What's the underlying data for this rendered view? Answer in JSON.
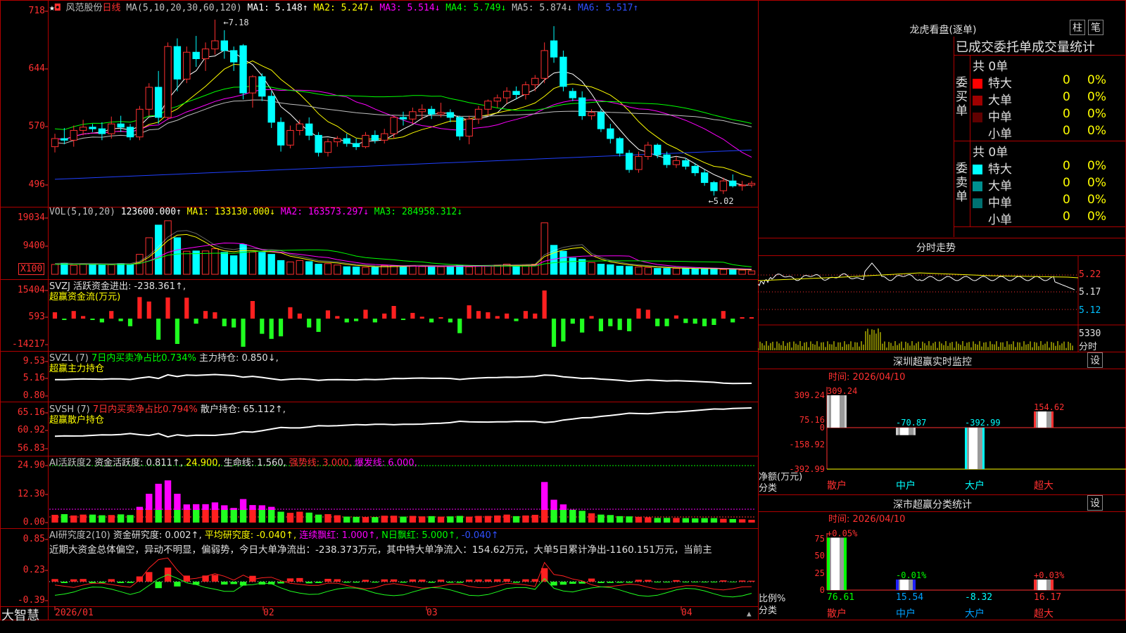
{
  "stock": {
    "name": "风范股份",
    "period": "日线",
    "ma_legend": [
      {
        "label": "MA(5,10,20,30,60,120)",
        "color": "#c0c0c0"
      },
      {
        "label": "MA1: 5.148↑",
        "color": "#ffffff"
      },
      {
        "label": "MA2: 5.247↓",
        "color": "#ffff00"
      },
      {
        "label": "MA3: 5.514↓",
        "color": "#ff00ff"
      },
      {
        "label": "MA4: 5.749↓",
        "color": "#00ff00"
      },
      {
        "label": "MA5: 5.874↓",
        "color": "#c0c0c0"
      },
      {
        "label": "MA6: 5.517↑",
        "color": "#3050ff"
      }
    ],
    "high_label": "7.18",
    "low_label": "5.02"
  },
  "price_axis": [
    "718",
    "644",
    "570",
    "496"
  ],
  "vol": {
    "legend": [
      {
        "label": "VOL(5,10,20)",
        "color": "#c0c0c0"
      },
      {
        "label": "123600.000↑",
        "color": "#ffffff"
      },
      {
        "label": "MA1: 133130.000↓",
        "color": "#ffff00"
      },
      {
        "label": "MA2: 163573.297↓",
        "color": "#ff00ff"
      },
      {
        "label": "MA3: 284958.312↓",
        "color": "#00ff00"
      }
    ],
    "axis": [
      "19034",
      "9400"
    ],
    "unit": "X100"
  },
  "svzj": {
    "legend": [
      {
        "label": "SVZJ  活跃资金进出: -238.361↑,",
        "color": "#e0e0e0"
      }
    ],
    "subtitle": "超赢资金流(万元)",
    "axis": [
      "15404",
      "593",
      "-14217"
    ]
  },
  "svzl": {
    "legend": [
      {
        "label": "SVZL (7)",
        "color": "#c0c0c0"
      },
      {
        "label": "7日内买卖净占比0.734%",
        "color": "#00ff00"
      },
      {
        "label": "主力持仓: 0.850↓,",
        "color": "#e0e0e0"
      }
    ],
    "subtitle": "超赢主力持仓",
    "axis": [
      "9.53",
      "5.16",
      "0.80"
    ]
  },
  "svsh": {
    "legend": [
      {
        "label": "SVSH (7)",
        "color": "#c0c0c0"
      },
      {
        "label": "7日内买卖净占比0.794%",
        "color": "#ff3030"
      },
      {
        "label": "散户持仓: 65.112↑,",
        "color": "#e0e0e0"
      }
    ],
    "subtitle": "超赢散户持仓",
    "axis": [
      "65.16",
      "60.92",
      "56.83"
    ]
  },
  "ai1": {
    "legend": [
      {
        "label": "AI活跃度2",
        "color": "#c0c0c0"
      },
      {
        "label": "资金活跃度: 0.811↑,",
        "color": "#e0e0e0"
      },
      {
        "label": "24.900,",
        "color": "#ffff00"
      },
      {
        "label": "生命线: 1.560,",
        "color": "#e0e0e0"
      },
      {
        "label": "强势线: 3.000,",
        "color": "#ff3030"
      },
      {
        "label": "爆发线: 6.000,",
        "color": "#ff00ff"
      }
    ],
    "axis": [
      "24.90",
      "12.30",
      "0.00"
    ]
  },
  "ai2": {
    "legend": [
      {
        "label": "AI研究度2(10)",
        "color": "#c0c0c0"
      },
      {
        "label": "资金研究度: 0.002↑,",
        "color": "#e0e0e0"
      },
      {
        "label": "平均研究度: -0.040↑,",
        "color": "#ffff00"
      },
      {
        "label": "连续飘红: 1.000↑,",
        "color": "#ff00ff"
      },
      {
        "label": "N日飘红: 5.000↑,",
        "color": "#00ff00"
      },
      {
        "label": "-0.040↑",
        "color": "#3050ff"
      }
    ],
    "comment": "近期大资金总体偏空，异动不明显，偏弱势，今日大单净流出：-238.373万元，其中特大单净流入：154.62万元，大单5日累计净出-1160.151万元，当前主",
    "axis": [
      "0.85",
      "0.23",
      "-0.39"
    ]
  },
  "date_axis": [
    "2026/01",
    "02",
    "03",
    "04"
  ],
  "brand": "大智慧",
  "right": {
    "lhb_title": "龙虎看盘(逐单)",
    "btn_zhu": "柱",
    "btn_bi": "笔",
    "stats_title": "已成交委托单成交量统计",
    "buy_label": "委买单",
    "sell_label": "委卖单",
    "buy_total": "共 0单",
    "sell_total": "共 0单",
    "buy_rows": [
      {
        "name": "特大",
        "val": "0",
        "pct": "0%",
        "color": "#ff0000"
      },
      {
        "name": "大单",
        "val": "0",
        "pct": "0%",
        "color": "#a00000"
      },
      {
        "name": "中单",
        "val": "0",
        "pct": "0%",
        "color": "#600000"
      },
      {
        "name": "小单",
        "val": "0",
        "pct": "0%",
        "color": ""
      }
    ],
    "sell_rows": [
      {
        "name": "特大",
        "val": "0",
        "pct": "0%",
        "color": "#00ffff"
      },
      {
        "name": "大单",
        "val": "0",
        "pct": "0%",
        "color": "#009090"
      },
      {
        "name": "中单",
        "val": "0",
        "pct": "0%",
        "color": "#007070"
      },
      {
        "name": "小单",
        "val": "0",
        "pct": "0%",
        "color": ""
      }
    ],
    "intraday_title": "分时走势",
    "intraday_axis": [
      "5.22",
      "5.17",
      "5.12"
    ],
    "intraday_vol": "5330",
    "intraday_unit": "分时",
    "sz_monitor_title": "深圳超赢实时监控",
    "sz_monitor_btn": "设",
    "sz_monitor_time": "时间: 2026/04/10",
    "sz_monitor_axis": [
      "309.24",
      "75.16",
      "0",
      "-158.92",
      "-392.99"
    ],
    "sz_monitor_ylabel": "净额(万元)",
    "sz_monitor_xlabel": "分类",
    "sz_classify_title": "深市超赢分类统计",
    "sz_classify_btn": "设",
    "sz_classify_time": "时间: 2026/04/10",
    "sz_classify_axis": [
      "75",
      "50",
      "25",
      "0"
    ],
    "sz_classify_ylabel": "比例%",
    "sz_classify_xlabel": "分类"
  },
  "chart_data": [
    {
      "type": "candlestick",
      "title": "风范股份 日线",
      "ylim": [
        4.9,
        7.3
      ],
      "ohlc": [
        [
          5.62,
          5.78,
          5.55,
          5.72
        ],
        [
          5.72,
          5.85,
          5.65,
          5.7
        ],
        [
          5.7,
          5.88,
          5.62,
          5.82
        ],
        [
          5.82,
          5.95,
          5.76,
          5.86
        ],
        [
          5.86,
          5.9,
          5.8,
          5.84
        ],
        [
          5.84,
          5.92,
          5.7,
          5.78
        ],
        [
          5.78,
          5.99,
          5.72,
          5.9
        ],
        [
          5.9,
          6.0,
          5.8,
          5.86
        ],
        [
          5.86,
          5.9,
          5.7,
          5.74
        ],
        [
          5.74,
          6.12,
          5.7,
          6.08
        ],
        [
          6.08,
          6.4,
          6.0,
          6.35
        ],
        [
          6.35,
          6.55,
          5.9,
          5.98
        ],
        [
          5.98,
          6.9,
          5.95,
          6.85
        ],
        [
          6.85,
          6.95,
          6.3,
          6.45
        ],
        [
          6.45,
          6.85,
          6.4,
          6.78
        ],
        [
          6.78,
          6.98,
          6.6,
          6.7
        ],
        [
          6.7,
          6.9,
          6.55,
          6.82
        ],
        [
          6.82,
          7.18,
          6.75,
          6.92
        ],
        [
          6.92,
          7.05,
          6.7,
          6.8
        ],
        [
          6.8,
          6.85,
          6.55,
          6.66
        ],
        [
          6.86,
          6.88,
          6.2,
          6.28
        ],
        [
          6.28,
          6.5,
          6.1,
          6.48
        ],
        [
          6.48,
          6.52,
          6.18,
          6.24
        ],
        [
          6.24,
          6.3,
          5.85,
          5.92
        ],
        [
          5.92,
          5.98,
          5.56,
          5.64
        ],
        [
          5.64,
          5.88,
          5.6,
          5.82
        ],
        [
          5.82,
          5.95,
          5.76,
          5.9
        ],
        [
          5.9,
          5.98,
          5.7,
          5.76
        ],
        [
          5.76,
          5.8,
          5.5,
          5.55
        ],
        [
          5.55,
          5.72,
          5.5,
          5.68
        ],
        [
          5.68,
          5.75,
          5.62,
          5.72
        ],
        [
          5.72,
          5.78,
          5.62,
          5.66
        ],
        [
          5.66,
          5.72,
          5.58,
          5.62
        ],
        [
          5.62,
          5.8,
          5.6,
          5.76
        ],
        [
          5.76,
          5.82,
          5.66,
          5.7
        ],
        [
          5.7,
          5.84,
          5.66,
          5.78
        ],
        [
          5.78,
          6.0,
          5.72,
          5.98
        ],
        [
          5.98,
          6.05,
          5.88,
          5.96
        ],
        [
          5.96,
          6.1,
          5.9,
          6.05
        ],
        [
          6.05,
          6.14,
          5.95,
          6.08
        ],
        [
          6.08,
          6.12,
          5.96,
          6.02
        ],
        [
          6.02,
          6.16,
          5.98,
          6.04
        ],
        [
          6.04,
          6.08,
          5.92,
          5.98
        ],
        [
          5.98,
          6.0,
          5.7,
          5.75
        ],
        [
          5.75,
          6.0,
          5.65,
          5.96
        ],
        [
          5.96,
          6.12,
          5.9,
          6.08
        ],
        [
          6.08,
          6.2,
          6.0,
          6.18
        ],
        [
          6.18,
          6.26,
          6.1,
          6.22
        ],
        [
          6.22,
          6.35,
          6.15,
          6.3
        ],
        [
          6.3,
          6.36,
          6.2,
          6.26
        ],
        [
          6.26,
          6.42,
          6.2,
          6.38
        ],
        [
          6.38,
          6.5,
          6.3,
          6.46
        ],
        [
          6.46,
          6.9,
          6.4,
          6.8
        ],
        [
          6.92,
          7.1,
          6.65,
          6.72
        ],
        [
          6.72,
          6.8,
          6.3,
          6.36
        ],
        [
          6.3,
          6.34,
          6.18,
          6.22
        ],
        [
          6.22,
          6.3,
          5.95,
          6.0
        ],
        [
          6.0,
          6.08,
          5.95,
          6.04
        ],
        [
          6.04,
          6.08,
          5.8,
          5.84
        ],
        [
          5.84,
          5.9,
          5.66,
          5.72
        ],
        [
          5.72,
          5.74,
          5.5,
          5.54
        ],
        [
          5.54,
          5.58,
          5.3,
          5.34
        ],
        [
          5.34,
          5.56,
          5.3,
          5.5
        ],
        [
          5.5,
          5.68,
          5.46,
          5.64
        ],
        [
          5.64,
          5.66,
          5.48,
          5.52
        ],
        [
          5.52,
          5.56,
          5.36,
          5.4
        ],
        [
          5.4,
          5.5,
          5.36,
          5.45
        ],
        [
          5.45,
          5.48,
          5.34,
          5.38
        ],
        [
          5.38,
          5.42,
          5.26,
          5.3
        ],
        [
          5.3,
          5.34,
          5.14,
          5.18
        ],
        [
          5.18,
          5.2,
          5.02,
          5.08
        ],
        [
          5.08,
          5.24,
          5.04,
          5.2
        ],
        [
          5.2,
          5.28,
          5.12,
          5.14
        ],
        [
          5.14,
          5.2,
          5.08,
          5.15
        ],
        [
          5.15,
          5.2,
          5.12,
          5.17
        ]
      ]
    },
    {
      "type": "bar",
      "title": "VOL(5,10,20)",
      "ylim": [
        0,
        20000
      ],
      "values": [
        3500,
        3800,
        3200,
        3600,
        3600,
        3300,
        3400,
        3700,
        3400,
        7100,
        13000,
        17500,
        19034,
        13000,
        8200,
        8300,
        8300,
        9100,
        7800,
        6600,
        10600,
        7900,
        7800,
        7100,
        4900,
        4400,
        4900,
        4500,
        3600,
        3800,
        3300,
        2700,
        2600,
        2500,
        2500,
        3100,
        3100,
        2700,
        3000,
        2800,
        2900,
        2700,
        2800,
        3000,
        2700,
        3000,
        3000,
        3200,
        3600,
        2900,
        3200,
        3500,
        18300,
        10300,
        8200,
        5800,
        5300,
        4200,
        3600,
        3400,
        2900,
        2800,
        2600,
        2400,
        2100,
        2100,
        2100,
        2000,
        1900,
        2000,
        2000,
        1700,
        1600,
        1500,
        1236
      ]
    }
  ]
}
